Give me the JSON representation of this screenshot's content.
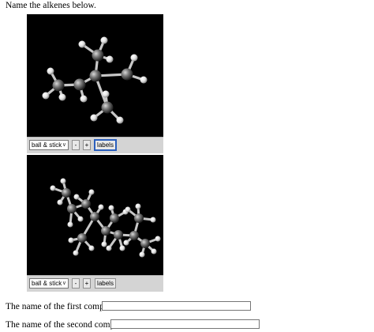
{
  "prompt": "Name the alkenes below.",
  "viewers": [
    {
      "style_select": "ball & stick",
      "minus_label": "-",
      "plus_label": "+",
      "labels_label": "labels"
    },
    {
      "style_select": "ball & stick",
      "minus_label": "-",
      "plus_label": "+",
      "labels_label": "labels"
    }
  ],
  "questions": [
    {
      "label": "The name of the first compound is",
      "value": ""
    },
    {
      "label": "The name of the second compound is",
      "value": ""
    }
  ],
  "colors": {
    "viewer_bg": "#000000",
    "carbon": "#7a7a7a",
    "hydrogen": "#f2f2f2",
    "toolbar": "#d4d4d4"
  },
  "icons": {
    "dropdown": "chevron-down-icon"
  }
}
